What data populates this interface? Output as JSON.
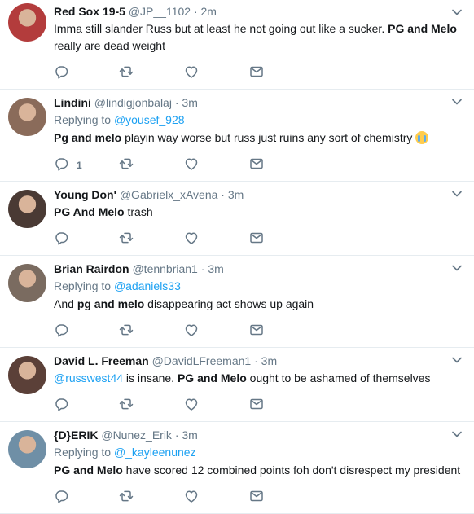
{
  "tweets": [
    {
      "name": "Red Sox 19-5",
      "handle": "@JP__1102",
      "time": "2m",
      "avatar_color": "#b33c3c",
      "parts": [
        {
          "t": "Imma still slander Russ but at least he not going out like a sucker. ",
          "s": "plain"
        },
        {
          "t": "PG and Melo",
          "s": "bold"
        },
        {
          "t": " really are dead weight",
          "s": "plain"
        }
      ],
      "reply_count": ""
    },
    {
      "name": "Lindini",
      "handle": "@lindigjonbalaj",
      "time": "3m",
      "avatar_color": "#8a6b5a",
      "replying_label": "Replying to",
      "replying_to": "@yousef_928",
      "parts": [
        {
          "t": "Pg and melo",
          "s": "bold"
        },
        {
          "t": " playin way worse but russ just ruins any sort of chemistry ",
          "s": "plain"
        }
      ],
      "emoji": "loudly-crying-face",
      "reply_count": "1"
    },
    {
      "name": "Young Don'",
      "handle": "@Gabrielx_xAvena",
      "time": "3m",
      "avatar_color": "#4a3a34",
      "parts": [
        {
          "t": "PG And Melo",
          "s": "bold"
        },
        {
          "t": " trash",
          "s": "plain"
        }
      ],
      "reply_count": ""
    },
    {
      "name": "Brian Rairdon",
      "handle": "@tennbrian1",
      "time": "3m",
      "avatar_color": "#7a6b60",
      "replying_label": "Replying to",
      "replying_to": "@adaniels33",
      "parts": [
        {
          "t": "And ",
          "s": "plain"
        },
        {
          "t": "pg and melo",
          "s": "bold"
        },
        {
          "t": " disappearing act shows up again",
          "s": "plain"
        }
      ],
      "reply_count": ""
    },
    {
      "name": "David L. Freeman",
      "handle": "@DavidLFreeman1",
      "time": "3m",
      "avatar_color": "#5b4038",
      "parts": [
        {
          "t": "@russwest44",
          "s": "mention"
        },
        {
          "t": " is insane. ",
          "s": "plain"
        },
        {
          "t": "PG and Melo",
          "s": "bold"
        },
        {
          "t": " ought to be ashamed of themselves",
          "s": "plain"
        }
      ],
      "reply_count": ""
    },
    {
      "name": "{D}ERIK",
      "handle": "@Nunez_Erik",
      "time": "3m",
      "avatar_color": "#6f8fa6",
      "replying_label": "Replying to",
      "replying_to": "@_kayleenunez",
      "parts": [
        {
          "t": "PG and Melo",
          "s": "bold"
        },
        {
          "t": " have scored 12 combined points foh don't disrespect my president",
          "s": "plain"
        }
      ],
      "reply_count": ""
    }
  ],
  "icons": {
    "reply": "reply-icon",
    "retweet": "retweet-icon",
    "like": "heart-icon",
    "dm": "envelope-icon",
    "caret": "chevron-down-icon"
  },
  "colors": {
    "link": "#1da1f2",
    "muted": "#657786",
    "text": "#14171a",
    "divider": "#e6ecf0"
  }
}
